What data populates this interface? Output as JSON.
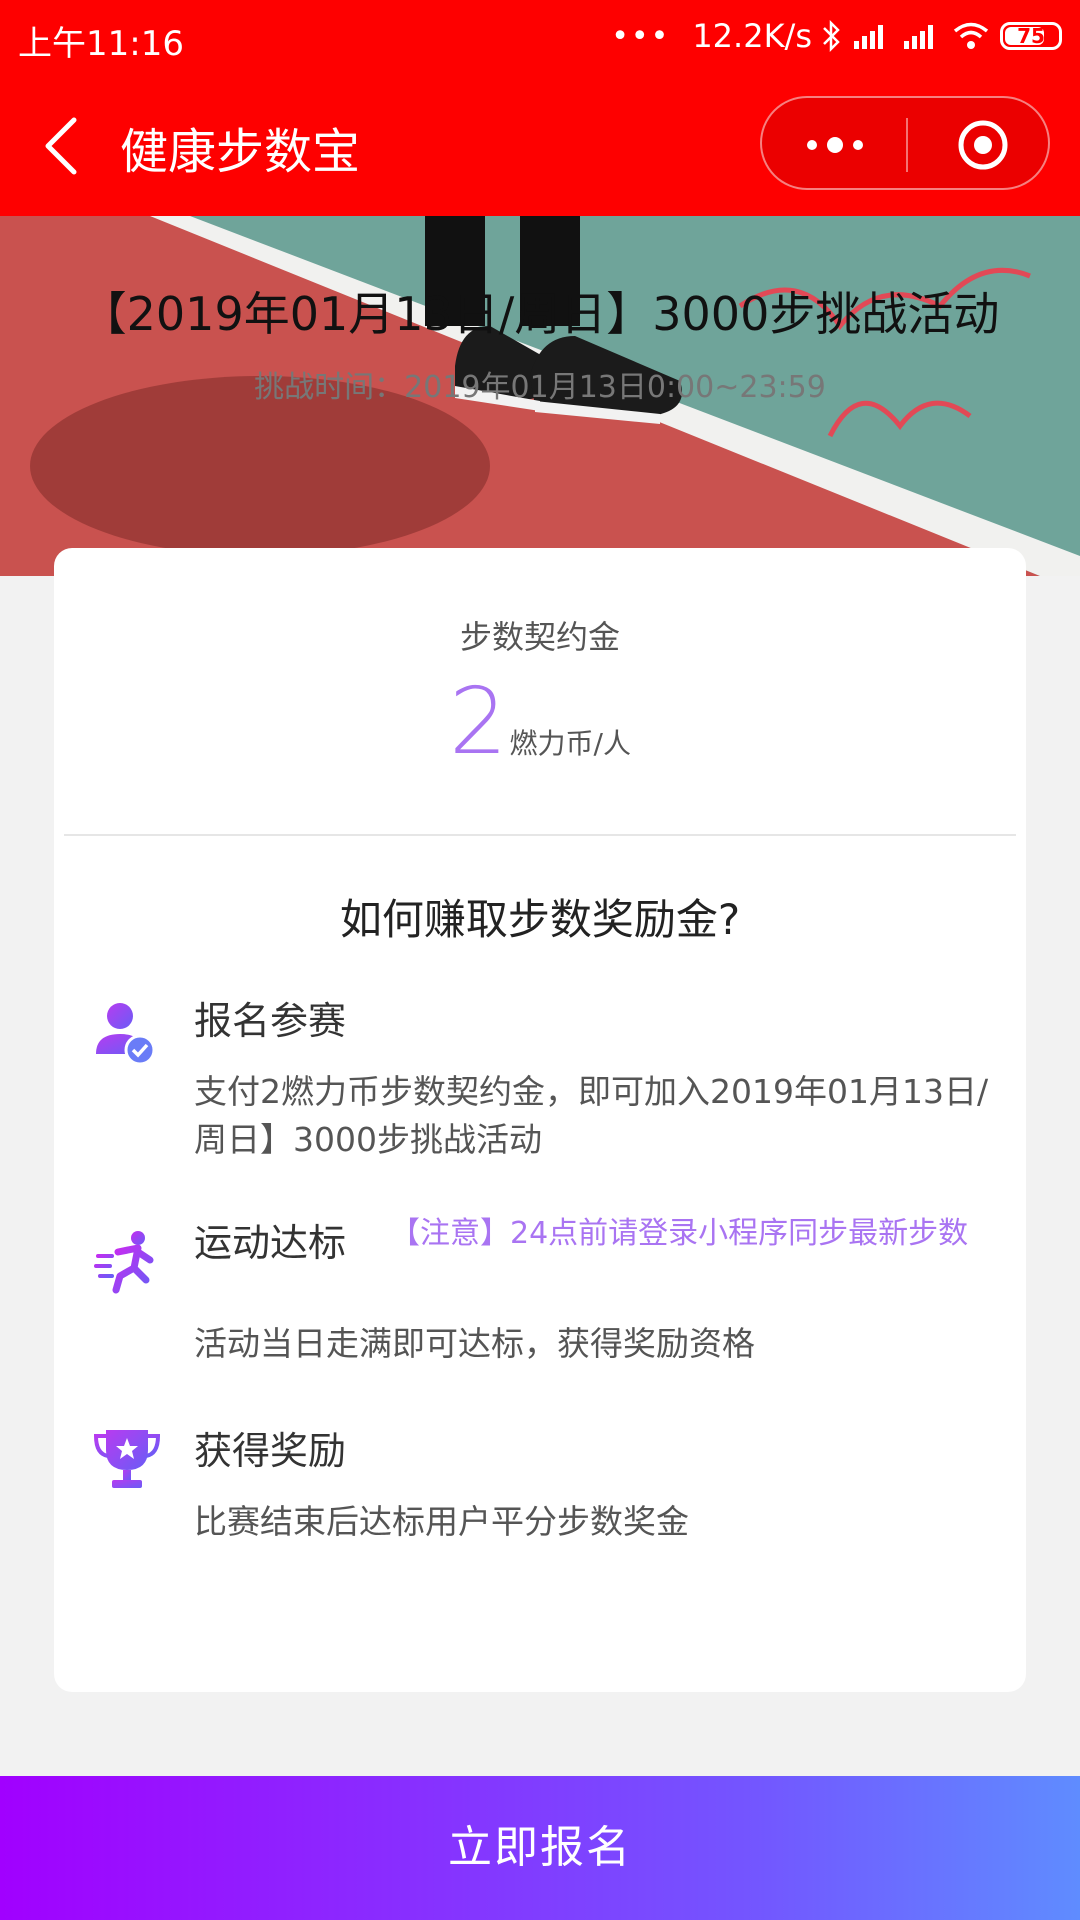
{
  "status_bar": {
    "time": "上午11:16",
    "dots": "•••",
    "network_speed": "12.2K/s",
    "battery": "75"
  },
  "nav": {
    "title": "健康步数宝"
  },
  "banner": {
    "title": "【2019年01月13日/周日】3000步挑战活动",
    "subtitle": "挑战时间：2019年01月13日0:00~23:59"
  },
  "deposit": {
    "label": "步数契约金",
    "amount": "2",
    "unit": "燃力币/人"
  },
  "how_to": {
    "title": "如何赚取步数奖励金?",
    "steps": [
      {
        "icon": "user-check-icon",
        "title": "报名参赛",
        "desc": "支付2燃力币步数契约金，即可加入2019年01月13日/周日】3000步挑战活动"
      },
      {
        "icon": "running-icon",
        "title": "运动达标",
        "note": "【注意】24点前请登录小程序同步最新步数",
        "desc": "活动当日走满即可达标，获得奖励资格"
      },
      {
        "icon": "trophy-icon",
        "title": "获得奖励",
        "desc": "比赛结束后达标用户平分步数奖金"
      }
    ]
  },
  "join_button": "立即报名",
  "colors": {
    "header_red": "#fe0000",
    "accent_purple": "#a974f2",
    "button_gradient_start": "#a100ff",
    "button_gradient_end": "#5f8cff"
  }
}
